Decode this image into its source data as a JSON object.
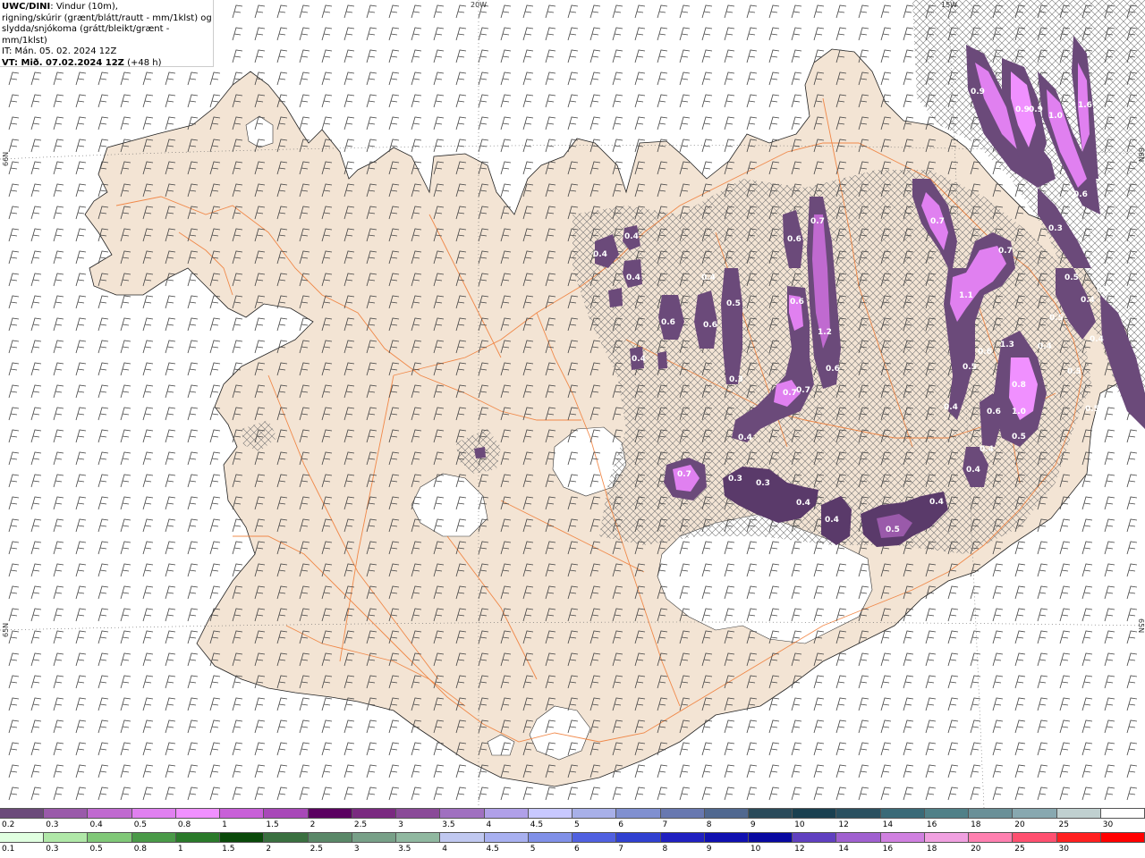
{
  "info": {
    "model": "UWC/DINI",
    "line1": ": Vindur (10m),",
    "line2": "rigning/skúrir (grænt/blátt/rautt - mm/1klst) og",
    "line3": "slydda/snjókoma (grátt/bleikt/grænt - mm/1klst)",
    "line4": "IT: Mán. 05. 02. 2024 12Z",
    "vt_label": "VT: Mið. 07.02.2024 12Z",
    "vt_suffix": " (+48 h)"
  },
  "grid_labels": {
    "lon20": "20W",
    "lon15": "15W",
    "lat66_left": "66N",
    "lat65_left": "65N",
    "lat66_right": "66N",
    "lat65_right": "65N"
  },
  "precip_values": [
    "0.9",
    "0.9",
    "0.9",
    "1.0",
    "1.6",
    "0.6",
    "0.3",
    "0.7",
    "0.7",
    "1.1",
    "0.5",
    "0.6",
    "0.5",
    "1.3",
    "0.4",
    "0.5",
    "0.6",
    "0.8",
    "1.0",
    "0.5",
    "0.4",
    "0.4",
    "0.4",
    "0.6",
    "0.7",
    "0.6",
    "1.2",
    "0.6",
    "0.5",
    "0.6",
    "0.6",
    "0.4",
    "0.3",
    "0.7",
    "0.7",
    "0.4",
    "0.3",
    "0.3",
    "0.4",
    "0.4",
    "0.5",
    "0.4",
    "0.4",
    "0.7",
    "0.4",
    "0.4",
    "0.4",
    "0.4",
    "0.5",
    "0.5",
    "0.4",
    "0.5"
  ],
  "colors": {
    "land": "#f3e4d4",
    "road": "#f07830",
    "glacier": "#ffffff",
    "sea": "#ffffff"
  },
  "legend_top": {
    "labels": [
      "0.2",
      "0.3",
      "0.4",
      "0.5",
      "0.8",
      "1",
      "1.5",
      "2",
      "2.5",
      "3",
      "3.5",
      "4",
      "4.5",
      "5",
      "6",
      "7",
      "8",
      "9",
      "10",
      "12",
      "14",
      "16",
      "18",
      "20",
      "25",
      "30"
    ],
    "colors": [
      "#6b4a7a",
      "#9a5aaa",
      "#c06ad0",
      "#e080f0",
      "#f090ff",
      "#c860d8",
      "#a848b8",
      "#5a0060",
      "#7a2a80",
      "#8a4a98",
      "#a070c0",
      "#b0a0e8",
      "#c8c8ff",
      "#a8b0e8",
      "#8090d0",
      "#6878b0",
      "#506890",
      "#2a4a5a",
      "#1a4050",
      "#2a5060",
      "#3a6a78",
      "#508088",
      "#6a9098",
      "#88a8b0",
      "#c0d0d0",
      "#ffffff"
    ]
  },
  "legend_bottom": {
    "labels": [
      "0.1",
      "0.3",
      "0.5",
      "0.8",
      "1",
      "1.5",
      "2",
      "2.5",
      "3",
      "3.5",
      "4",
      "4.5",
      "5",
      "6",
      "7",
      "8",
      "9",
      "10",
      "12",
      "14",
      "16",
      "18",
      "20",
      "25",
      "30"
    ],
    "colors": [
      "#e0ffe0",
      "#b0e8a8",
      "#80c878",
      "#4a9a48",
      "#2a7a2a",
      "#0a4a0a",
      "#3a7040",
      "#5a8868",
      "#78a088",
      "#90b8a0",
      "#c0c8f0",
      "#a8b0f0",
      "#8090e8",
      "#5060e0",
      "#3040d0",
      "#2020c0",
      "#1010b0",
      "#0808a0",
      "#6040c0",
      "#a060d0",
      "#d080e0",
      "#f0a0e0",
      "#ff80b0",
      "#ff5070",
      "#ff2020",
      "#ff0000"
    ]
  }
}
